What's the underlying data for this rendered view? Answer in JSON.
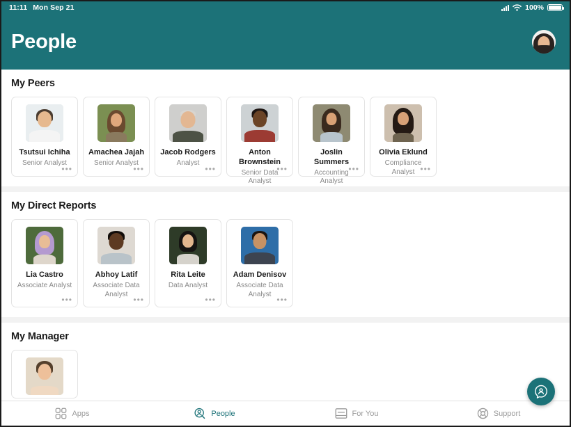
{
  "status_bar": {
    "time": "11:11",
    "date": "Mon Sep 21",
    "battery_percent": "100%",
    "signal_icon": "cellular-signal-icon",
    "wifi_icon": "wifi-icon",
    "battery_icon": "battery-icon"
  },
  "header": {
    "title": "People",
    "avatar": "user-avatar"
  },
  "colors": {
    "brand_teal": "#1c7278",
    "page_background": "#f2f2f2",
    "card_border": "#e3e3e3",
    "muted_text": "#8a8a8a"
  },
  "sections": [
    {
      "title": "My Peers",
      "people": [
        {
          "name": "Tsutsui Ichiha",
          "role": "Senior Analyst"
        },
        {
          "name": "Amachea Jajah",
          "role": "Senior Analyst"
        },
        {
          "name": "Jacob Rodgers",
          "role": "Analyst"
        },
        {
          "name": "Anton Brownstein",
          "role": "Senior Data Analyst"
        },
        {
          "name": "Joslin Summers",
          "role": "Accounting Analyst"
        },
        {
          "name": "Olivia Eklund",
          "role": "Compliance Analyst"
        }
      ]
    },
    {
      "title": "My Direct Reports",
      "people": [
        {
          "name": "Lia Castro",
          "role": "Associate Analyst"
        },
        {
          "name": "Abhoy Latif",
          "role": "Associate Data Analyst"
        },
        {
          "name": "Rita Leite",
          "role": "Data Analyst"
        },
        {
          "name": "Adam Denisov",
          "role": "Associate Data Analyst"
        }
      ]
    },
    {
      "title": "My Manager",
      "people": [
        {
          "name": "",
          "role": ""
        }
      ]
    }
  ],
  "card_menu_label": "•••",
  "fab": {
    "icon": "assistant-chat-icon"
  },
  "tabs": [
    {
      "label": "Apps",
      "icon": "apps-grid-icon",
      "active": false
    },
    {
      "label": "People",
      "icon": "people-search-icon",
      "active": true
    },
    {
      "label": "For You",
      "icon": "for-you-card-icon",
      "active": false
    },
    {
      "label": "Support",
      "icon": "lifebuoy-icon",
      "active": false
    }
  ]
}
